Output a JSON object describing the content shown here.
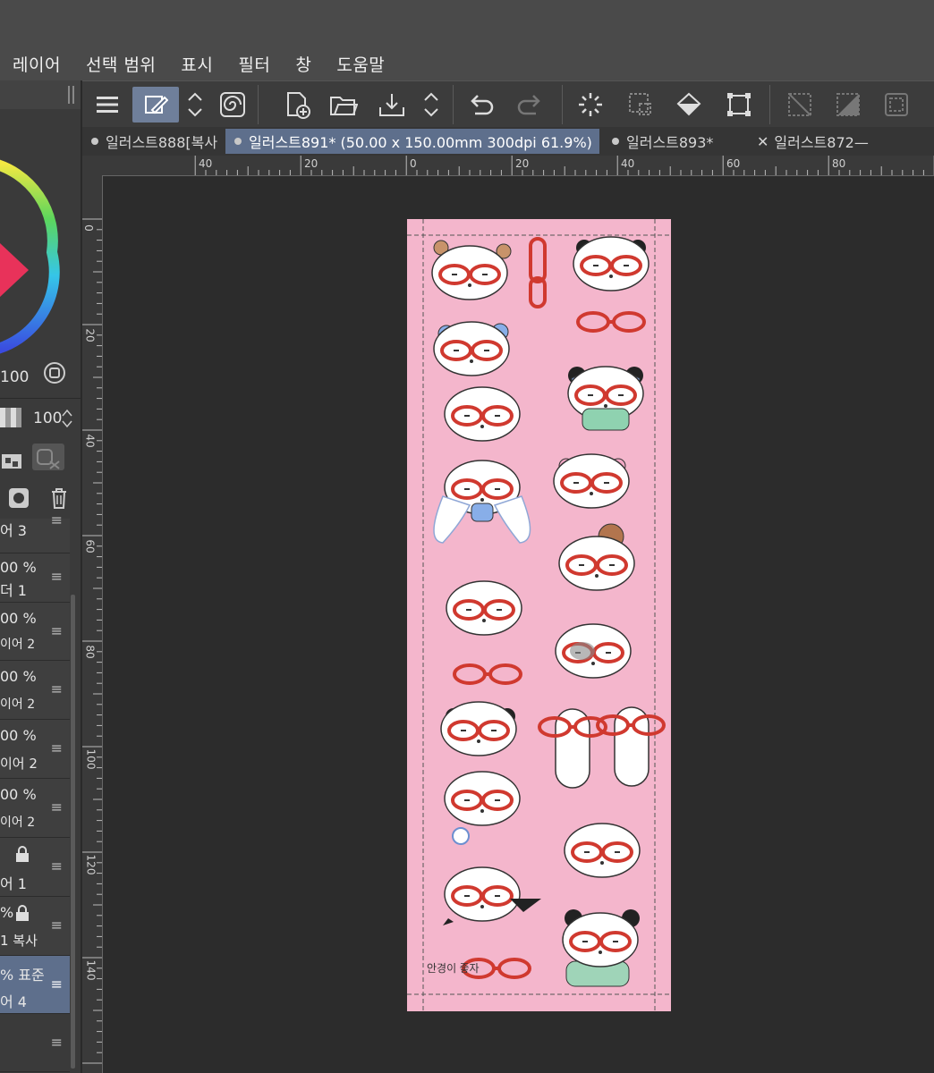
{
  "menu": [
    "레이어",
    "선택 범위",
    "표시",
    "필터",
    "창",
    "도움말"
  ],
  "tabs": [
    {
      "label": "일러스트888[복사",
      "marker": "dot",
      "active": false
    },
    {
      "label": "일러스트891* (50.00 x 150.00mm 300dpi 61.9%)",
      "marker": "dot",
      "active": true
    },
    {
      "label": "일러스트893*",
      "marker": "dot",
      "active": false
    },
    {
      "label": "일러스트872—",
      "marker": "close",
      "active": false
    }
  ],
  "hruler_labels": [
    "40",
    "20",
    "0",
    "20",
    "40",
    "60",
    "80"
  ],
  "vruler_labels": [
    "0",
    "20",
    "40",
    "60",
    "80",
    "100",
    "120",
    "140"
  ],
  "color_panel": {
    "value": "100"
  },
  "layer_panel": {
    "opacity": "100"
  },
  "layers": [
    {
      "line1": "어 3",
      "line2": ""
    },
    {
      "line1": "00 %",
      "line2": "더 1"
    },
    {
      "line1": "00 %",
      "line2": "이어 2"
    },
    {
      "line1": "00 %",
      "line2": "이어 2"
    },
    {
      "line1": "00 %",
      "line2": "이어 2"
    },
    {
      "line1": "00 %",
      "line2": "이어 2"
    },
    {
      "line1": "",
      "line2": "어 1"
    },
    {
      "line1": "%",
      "line2": "1 복사"
    },
    {
      "line1": "% 표준",
      "line2": "어 4"
    },
    {
      "line1": "",
      "line2": ""
    }
  ],
  "canvas": {
    "handwriting": "안경이 좋자"
  },
  "colors": {
    "paper": "#f4b6cc",
    "glasses": "#d0392f",
    "active_tab": "#5e6f8c"
  }
}
